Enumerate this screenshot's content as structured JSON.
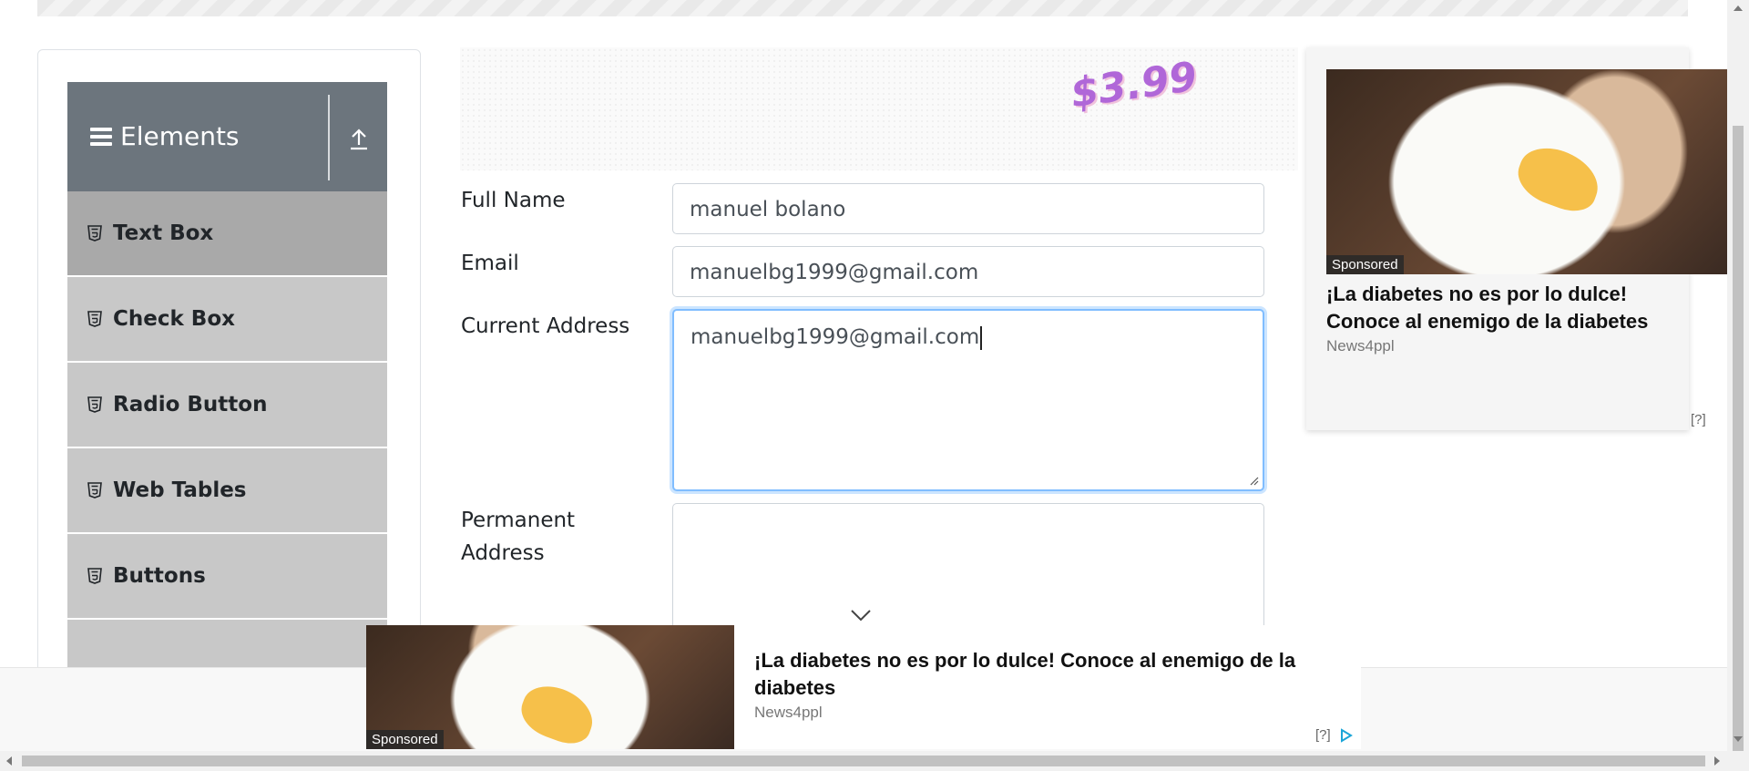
{
  "sidebar": {
    "group_title": "Elements",
    "items": [
      {
        "label": "Text Box",
        "active": true
      },
      {
        "label": "Check Box",
        "active": false
      },
      {
        "label": "Radio Button",
        "active": false
      },
      {
        "label": "Web Tables",
        "active": false
      },
      {
        "label": "Buttons",
        "active": false
      }
    ]
  },
  "form_ad": {
    "price": "$3.99"
  },
  "form": {
    "full_name_label": "Full Name",
    "full_name_value": "manuel bolano",
    "email_label": "Email",
    "email_value": "manuelbg1999@gmail.com",
    "current_address_label": "Current Address",
    "current_address_value": "manuelbg1999@gmail.com",
    "permanent_address_label_1": "Permanent",
    "permanent_address_label_2": "Address",
    "permanent_address_value": ""
  },
  "right_ad": {
    "badge": "Sponsored",
    "headline": "¡La diabetes no es por lo dulce! Conoce al enemigo de la diabetes",
    "source": "News4ppl",
    "qmark": "[?]"
  },
  "bottom_ad": {
    "badge": "Sponsored",
    "headline": "¡La diabetes no es por lo dulce! Conoce al enemigo de la diabetes",
    "source": "News4ppl",
    "qmark": "[?]"
  },
  "colors": {
    "sidebar_header": "#6c757d",
    "menu_item": "#c8c8c8",
    "menu_item_active": "#a9a9a9",
    "focus_border": "#80bdff"
  },
  "icons": [
    "menu-icon",
    "upload-icon",
    "html5-icon",
    "chevron-down-icon",
    "adchoices-icon"
  ]
}
